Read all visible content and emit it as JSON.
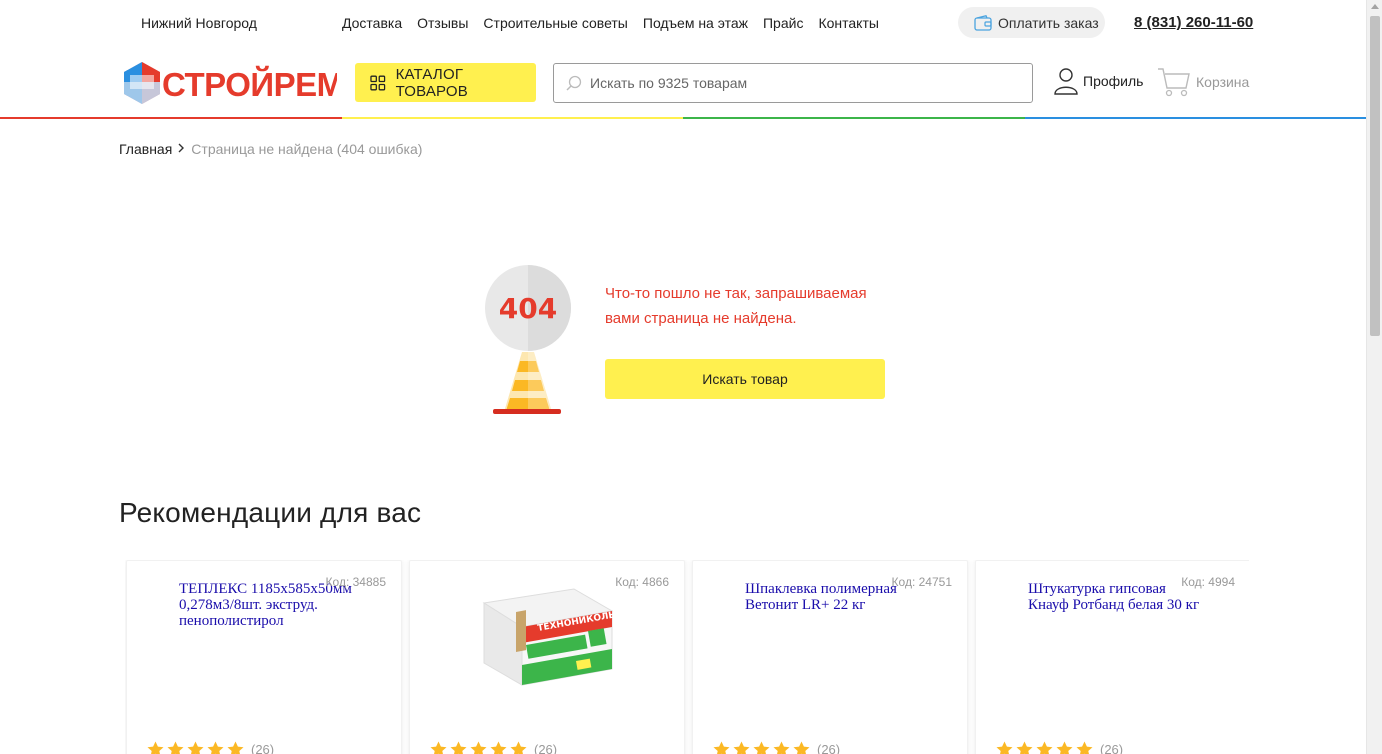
{
  "topbar": {
    "city": "Нижний Новгород",
    "nav": [
      "Доставка",
      "Отзывы",
      "Строительные советы",
      "Подъем на этаж",
      "Прайс",
      "Контакты"
    ],
    "pay_label": "Оплатить заказ",
    "phone": "8 (831) 260-11-60"
  },
  "header": {
    "logo_text": "СТРОЙРЕМ",
    "catalog_label": "КАТАЛОГ ТОВАРОВ",
    "search_placeholder": "Искать по 9325 товарам",
    "profile_label": "Профиль",
    "cart_label": "Корзина"
  },
  "colors": {
    "accent_yellow": "#fff04f",
    "error_red": "#e53b2c",
    "rainbow": [
      "#e53b2c",
      "#fff04f",
      "#3cb54a",
      "#2a8fe0"
    ]
  },
  "breadcrumb": {
    "home": "Главная",
    "current": "Страница не найдена (404 ошибка)"
  },
  "error": {
    "code": "404",
    "message": "Что-то пошло не так, запрашиваемая вами страница не найдена.",
    "button": "Искать товар"
  },
  "recommendations": {
    "title": "Рекомендации для вас",
    "items": [
      {
        "code": "Код: 34885",
        "alt": "ТЕПЛЕКС 1185х585х50мм 0,278м3/8шт. экструд. пенополистирол",
        "reviews": "(26)",
        "has_image": false
      },
      {
        "code": "Код: 4866",
        "alt": "",
        "image_text": "ТЕХНОНИКОЛЬ",
        "reviews": "(26)",
        "has_image": true
      },
      {
        "code": "Код: 24751",
        "alt": "Шпаклевка полимерная Ветонит LR+ 22 кг",
        "reviews": "(26)",
        "has_image": false
      },
      {
        "code": "Код: 4994",
        "alt": "Штукатурка гипсовая Кнауф Ротбанд белая 30 кг",
        "reviews": "(26)",
        "has_image": false
      }
    ]
  }
}
